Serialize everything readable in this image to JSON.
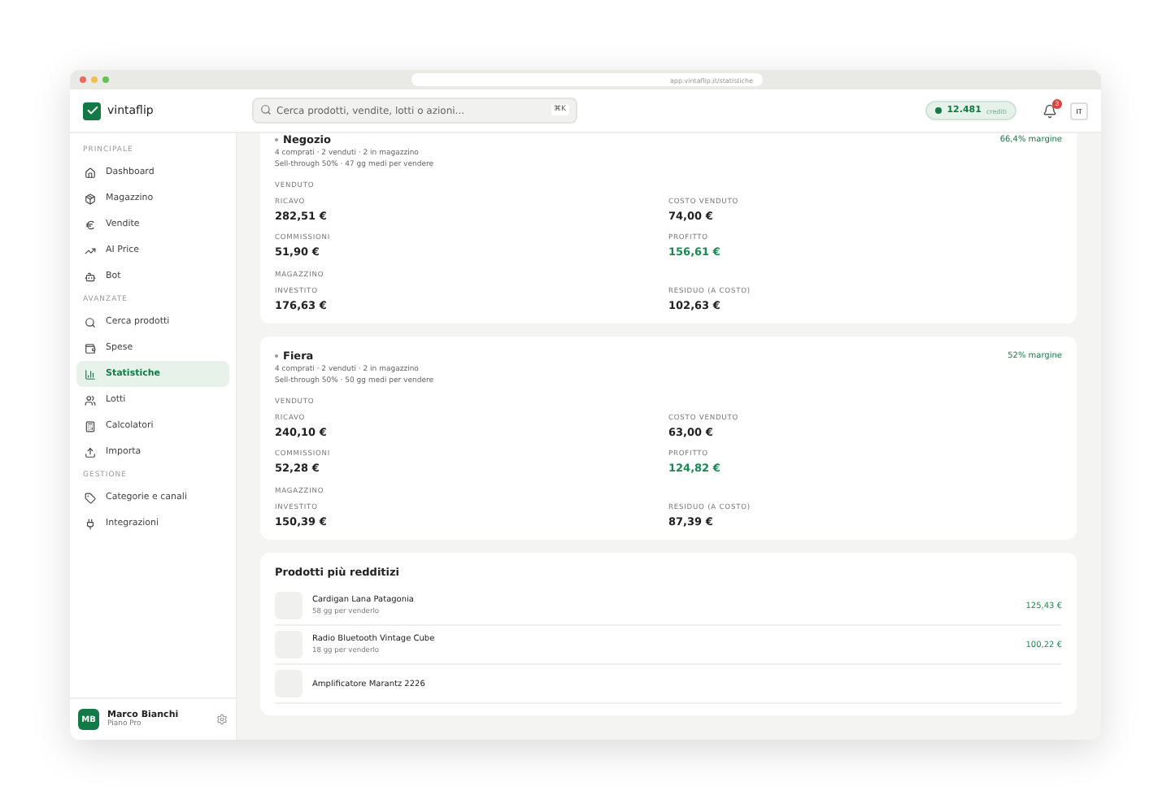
{
  "browser": {
    "url": "app.vintaflip.it/statistiche"
  },
  "app": {
    "logo": "vintaflip"
  },
  "search": {
    "placeholder": "Cerca prodotti, vendite, lotti o azioni...",
    "shortcut": "⌘K"
  },
  "credits": {
    "value": "12.481",
    "unit": "crediti"
  },
  "notifications": {
    "badge": "3"
  },
  "language": "IT",
  "sidebar": {
    "sections": [
      {
        "title": "PRINCIPALE",
        "items": [
          {
            "label": "Dashboard",
            "selected": false
          },
          {
            "label": "Magazzino",
            "selected": false
          },
          {
            "label": "Vendite",
            "selected": false
          },
          {
            "label": "AI Price",
            "selected": false
          },
          {
            "label": "Bot",
            "selected": false
          }
        ]
      },
      {
        "title": "AVANZATE",
        "items": [
          {
            "label": "Cerca prodotti",
            "selected": false
          },
          {
            "label": "Spese",
            "selected": false
          },
          {
            "label": "Statistiche",
            "selected": true
          },
          {
            "label": "Lotti",
            "selected": false
          },
          {
            "label": "Calcolatori",
            "selected": false
          },
          {
            "label": "Importa",
            "selected": false
          }
        ]
      },
      {
        "title": "GESTIONE",
        "items": [
          {
            "label": "Categorie e canali",
            "selected": false
          },
          {
            "label": "Integrazioni",
            "selected": false
          }
        ]
      }
    ]
  },
  "user": {
    "initials": "MB",
    "name": "Marco Bianchi",
    "plan": "Piano Pro"
  },
  "channels": [
    {
      "name": "Negozio",
      "margin": "66,4% margine",
      "summary": "4 comprati · 2 venduti · 2 in magazzino",
      "sell_through": "Sell-through 50% · 47 gg medi per vendere",
      "sold_title": "VENDUTO",
      "sold": [
        {
          "label": "RICAVO",
          "value": "282,51 €",
          "positive": false
        },
        {
          "label": "COSTO VENDUTO",
          "value": "74,00 €",
          "positive": false
        },
        {
          "label": "COMMISSIONI",
          "value": "51,90 €",
          "positive": false
        },
        {
          "label": "PROFITTO",
          "value": "156,61 €",
          "positive": true
        }
      ],
      "stock_title": "MAGAZZINO",
      "stock": [
        {
          "label": "INVESTITO",
          "value": "176,63 €",
          "positive": false
        },
        {
          "label": "RESIDUO (A COSTO)",
          "value": "102,63 €",
          "positive": false
        }
      ]
    },
    {
      "name": "Fiera",
      "margin": "52% margine",
      "summary": "4 comprati · 2 venduti · 2 in magazzino",
      "sell_through": "Sell-through 50% · 50 gg medi per vendere",
      "sold_title": "VENDUTO",
      "sold": [
        {
          "label": "RICAVO",
          "value": "240,10 €",
          "positive": false
        },
        {
          "label": "COSTO VENDUTO",
          "value": "63,00 €",
          "positive": false
        },
        {
          "label": "COMMISSIONI",
          "value": "52,28 €",
          "positive": false
        },
        {
          "label": "PROFITTO",
          "value": "124,82 €",
          "positive": true
        }
      ],
      "stock_title": "MAGAZZINO",
      "stock": [
        {
          "label": "INVESTITO",
          "value": "150,39 €",
          "positive": false
        },
        {
          "label": "RESIDUO (A COSTO)",
          "value": "87,39 €",
          "positive": false
        }
      ]
    }
  ],
  "top_products": {
    "title": "Prodotti più redditizi",
    "items": [
      {
        "name": "Cardigan Lana Patagonia",
        "detail": "58 gg per venderlo",
        "profit": "125,43 €"
      },
      {
        "name": "Radio Bluetooth Vintage Cube",
        "detail": "18 gg per venderlo",
        "profit": "100,22 €"
      },
      {
        "name": "Amplificatore Marantz 2226"
      }
    ]
  }
}
